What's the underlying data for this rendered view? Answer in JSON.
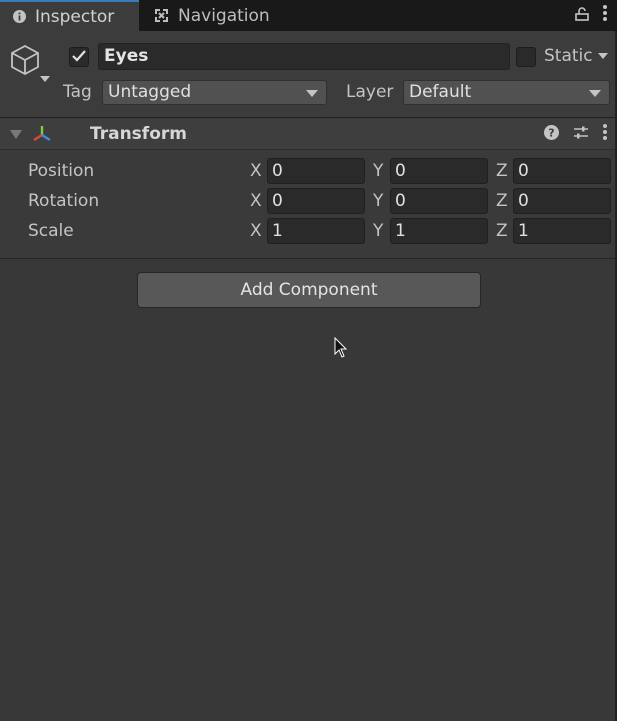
{
  "tabs": [
    {
      "label": "Inspector",
      "icon": "info-icon"
    },
    {
      "label": "Navigation",
      "icon": "navigation-icon"
    }
  ],
  "tab_actions": {
    "lock_icon": "lock-icon",
    "menu_icon": "kebab-menu-icon"
  },
  "object": {
    "active": true,
    "name": "Eyes",
    "static_label": "Static",
    "static": false,
    "tag_label": "Tag",
    "tag_value": "Untagged",
    "layer_label": "Layer",
    "layer_value": "Default"
  },
  "transform": {
    "title": "Transform",
    "rows": [
      {
        "label": "Position",
        "x": "0",
        "y": "0",
        "z": "0"
      },
      {
        "label": "Rotation",
        "x": "0",
        "y": "0",
        "z": "0"
      },
      {
        "label": "Scale",
        "x": "1",
        "y": "1",
        "z": "1"
      }
    ],
    "axes": {
      "x": "X",
      "y": "Y",
      "z": "Z"
    }
  },
  "add_component_label": "Add Component",
  "colors": {
    "accent": "#3a79bb",
    "panel": "#383838",
    "tabbar": "#191919"
  }
}
